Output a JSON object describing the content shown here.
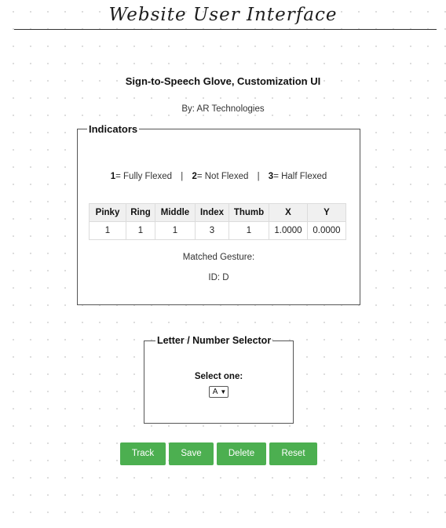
{
  "page": {
    "heading": "Website User Interface"
  },
  "app": {
    "title": "Sign-to-Speech Glove, Customization UI",
    "byline": "By: AR Technologies"
  },
  "indicators": {
    "legend": "Indicators",
    "key": [
      {
        "num": "1",
        "text": "= Fully Flexed"
      },
      {
        "num": "2",
        "text": "= Not Flexed"
      },
      {
        "num": "3",
        "text": "= Half Flexed"
      }
    ],
    "separator": "|",
    "table": {
      "headers": [
        "Pinky",
        "Ring",
        "Middle",
        "Index",
        "Thumb",
        "X",
        "Y"
      ],
      "row": [
        "1",
        "1",
        "1",
        "3",
        "1",
        "1.0000",
        "0.0000"
      ]
    },
    "matched_label": "Matched Gesture:",
    "matched_id": "ID: D"
  },
  "selector": {
    "legend": "Letter / Number Selector",
    "label": "Select one:",
    "selected": "A"
  },
  "buttons": {
    "track": "Track",
    "save": "Save",
    "delete": "Delete",
    "reset": "Reset"
  },
  "colors": {
    "button_bg": "#4caf50",
    "button_text": "#ffffff"
  }
}
